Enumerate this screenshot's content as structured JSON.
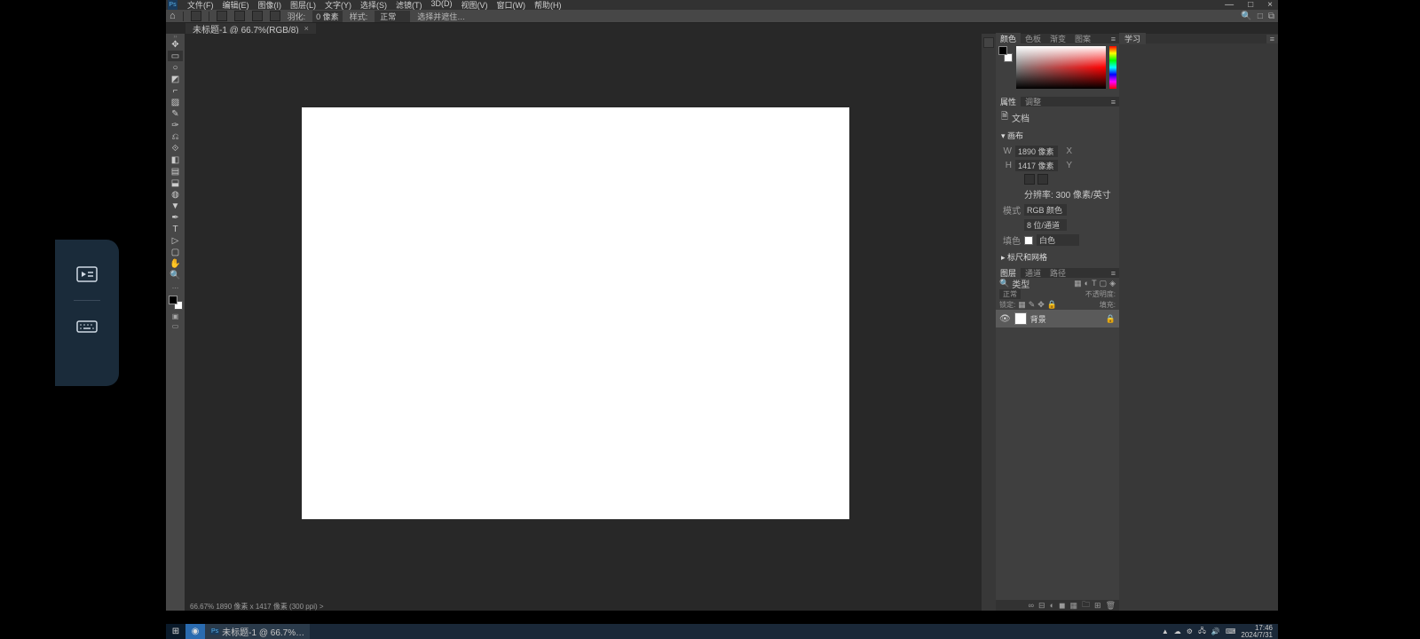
{
  "app_icon": "Ps",
  "menu": {
    "file": "文件(F)",
    "edit": "编辑(E)",
    "image": "图像(I)",
    "layer": "图层(L)",
    "type": "文字(Y)",
    "select": "选择(S)",
    "filter": "滤镜(T)",
    "3d": "3D(D)",
    "view": "视图(V)",
    "window": "窗口(W)",
    "help": "帮助(H)"
  },
  "window_ctl": {
    "min": "—",
    "max": "□",
    "close": "×"
  },
  "optbar": {
    "home": "⌂",
    "feather_l": "羽化:",
    "feather_v": "0 像素",
    "mode_l": "样式:",
    "mode_v": "正常",
    "sel_l": "选择并遮住…"
  },
  "optright": {
    "search": "🔍",
    "a1": "□",
    "a2": "⧉"
  },
  "doc": {
    "tab": "未标题-1 @ 66.7%(RGB/8)",
    "x": "×"
  },
  "status": "66.67%   1890 像素 x 1417 像素 (300 ppi)   >",
  "tools": [
    "✥",
    "▭",
    "○",
    "◩",
    "⌐",
    "▨",
    "✎",
    "✑",
    "⎌",
    "⟐",
    "◧",
    "▤",
    "⬓",
    "◍",
    "▼",
    "✒",
    "T",
    "▷",
    "▢",
    "✋",
    "🔍",
    "…"
  ],
  "color_tabs": {
    "t1": "颜色",
    "t2": "色板",
    "t3": "渐变",
    "t4": "图案"
  },
  "prop_tabs": {
    "t1": "属性",
    "t2": "调整"
  },
  "prop": {
    "doc": "文档",
    "canvas": "▾ 画布",
    "w": "W",
    "wv": "1890 像素",
    "x": "X",
    "xv": "",
    "h": "H",
    "hv": "1417 像素",
    "y": "Y",
    "yv": "",
    "res": "分辨率: 300 像素/英寸",
    "model": "模式",
    "modev": "RGB 颜色",
    "depth": "8 位/通道",
    "fill": "填色",
    "fillv": "白色",
    "ruler": "▸ 标尺和网格"
  },
  "layers_tabs": {
    "t1": "图层",
    "t2": "通道",
    "t3": "路径"
  },
  "layers": {
    "kind_l": "类型",
    "opacity_l": "正常",
    "opacity_v": "不透明度:",
    "lock_l": "锁定:",
    "fill_l": "填充:",
    "layer_name": "背景",
    "eye": "👁",
    "lock": "🔒"
  },
  "lfooter": [
    "∞",
    "⊟",
    "◐",
    "◼",
    "▦",
    "🗀",
    "⊞",
    "🗑"
  ],
  "rpane_tab": "学习",
  "taskbar": {
    "start": "⊞",
    "search": "◉",
    "ps": "Ps",
    "pstitle": "未标题-1 @ 66.7%…"
  },
  "tray": {
    "i1": "▲",
    "i2": "☁",
    "i3": "⚙",
    "i4": "🖧",
    "i5": "🔊",
    "i6": "⌨",
    "time": "17:46",
    "date": "2024/7/31"
  }
}
